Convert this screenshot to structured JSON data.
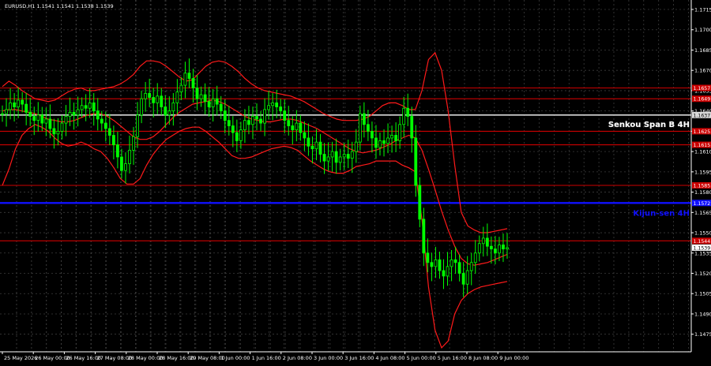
{
  "header": {
    "symbol_info": "EURUSD,H1  1.1541 1.1541 1.1538 1.1539"
  },
  "colors": {
    "background": "#000000",
    "grid": "#3c3c3c",
    "axis": "#ffffff",
    "candle": "#00ff00",
    "bollinger": "#ff1a1a",
    "levels": "#cc0000",
    "kijun": "#1010ff",
    "senkou": "#d9d9d9",
    "price_tag": "#cc0000"
  },
  "chart_data": {
    "type": "line",
    "title": "EURUSD,H1  1.1541 1.1541 1.1538 1.1539",
    "xlabel": "",
    "ylabel": "",
    "ylim": [
      1.1462,
      1.1722
    ],
    "price_ticks": [
      1.1475,
      1.149,
      1.1505,
      1.152,
      1.1535,
      1.155,
      1.1565,
      1.158,
      1.1595,
      1.161,
      1.1625,
      1.164,
      1.1655,
      1.167,
      1.1685,
      1.17,
      1.1715
    ],
    "time_labels": [
      "25 May 2026",
      "26 May 00:00",
      "26 May 16:00",
      "27 May 08:00",
      "28 May 00:00",
      "28 May 16:00",
      "29 May 08:00",
      "1 Jun 00:00",
      "1 Jun 16:00",
      "2 Jun 08:00",
      "3 Jun 00:00",
      "3 Jun 16:00",
      "4 Jun 08:00",
      "5 Jun 00:00",
      "5 Jun 16:00",
      "8 Jun 08:00",
      "9 Jun 00:00"
    ],
    "horizontal_levels": [
      {
        "value": 1.1657,
        "label": "1.1657",
        "kind": "support-resistance"
      },
      {
        "value": 1.1649,
        "label": "1.1649",
        "kind": "support-resistance"
      },
      {
        "value": 1.1637,
        "label": "1.1637",
        "kind": "senkou"
      },
      {
        "value": 1.1625,
        "label": "1.1625",
        "kind": "support-resistance"
      },
      {
        "value": 1.1615,
        "label": "1.1615",
        "kind": "support-resistance"
      },
      {
        "value": 1.1585,
        "label": "1.1585",
        "kind": "support-resistance"
      },
      {
        "value": 1.1572,
        "label": "1.1572",
        "kind": "kijun"
      },
      {
        "value": 1.1544,
        "label": "1.1544",
        "kind": "support-resistance"
      },
      {
        "value": 1.1539,
        "label": "1.1539",
        "kind": "current"
      }
    ],
    "annotations": [
      {
        "text": "Senkou Span B 4H",
        "anchor_value": 1.1637
      },
      {
        "text": "Kijun-sen 4H",
        "anchor_value": 1.1572
      }
    ],
    "series": [
      {
        "kind": "close",
        "values": [
          1.1638,
          1.1641,
          1.1646,
          1.1643,
          1.1648,
          1.1645,
          1.1639,
          1.1636,
          1.1633,
          1.1637,
          1.1631,
          1.1634,
          1.1627,
          1.1623,
          1.1625,
          1.1631,
          1.1636,
          1.1639,
          1.1637,
          1.1641,
          1.1644,
          1.1642,
          1.1646,
          1.164,
          1.1634,
          1.1631,
          1.1627,
          1.1622,
          1.1615,
          1.1606,
          1.1596,
          1.1601,
          1.1611,
          1.1621,
          1.1637,
          1.1649,
          1.1653,
          1.165,
          1.1646,
          1.1651,
          1.1643,
          1.1637,
          1.164,
          1.1646,
          1.1654,
          1.1659,
          1.1668,
          1.1664,
          1.1657,
          1.1649,
          1.1652,
          1.1647,
          1.1643,
          1.1649,
          1.1645,
          1.164,
          1.1633,
          1.1629,
          1.1624,
          1.1618,
          1.1626,
          1.1633,
          1.163,
          1.1636,
          1.1634,
          1.1631,
          1.1641,
          1.1644,
          1.1646,
          1.1643,
          1.164,
          1.1633,
          1.1629,
          1.1626,
          1.1631,
          1.1624,
          1.162,
          1.1614,
          1.1612,
          1.1617,
          1.1608,
          1.1603,
          1.1606,
          1.161,
          1.1602,
          1.1606,
          1.1608,
          1.1605,
          1.161,
          1.1617,
          1.1638,
          1.163,
          1.1625,
          1.162,
          1.1613,
          1.1618,
          1.1616,
          1.162,
          1.1622,
          1.1618,
          1.163,
          1.1642,
          1.1636,
          1.162,
          1.1585,
          1.156,
          1.1535,
          1.1528,
          1.1525,
          1.153,
          1.1522,
          1.1518,
          1.1525,
          1.153,
          1.1528,
          1.152,
          1.1512,
          1.1522,
          1.1528,
          1.1535,
          1.1542,
          1.1546,
          1.154,
          1.1538,
          1.1535,
          1.1541,
          1.1538,
          1.1539
        ]
      },
      {
        "kind": "bollinger-middle",
        "values": [
          1.164,
          1.1641,
          1.1641,
          1.164,
          1.1639,
          1.1638,
          1.1636,
          1.1634,
          1.1633,
          1.1632,
          1.1632,
          1.1633,
          1.1635,
          1.1637,
          1.1638,
          1.1638,
          1.1636,
          1.1633,
          1.1629,
          1.1625,
          1.1621,
          1.1619,
          1.1619,
          1.1621,
          1.1625,
          1.163,
          1.1635,
          1.1639,
          1.1642,
          1.1645,
          1.1646,
          1.1647,
          1.1648,
          1.1647,
          1.1645,
          1.1642,
          1.1639,
          1.1636,
          1.1634,
          1.1633,
          1.1632,
          1.1632,
          1.1633,
          1.1634,
          1.1634,
          1.1633,
          1.1631,
          1.1629,
          1.1627,
          1.1624,
          1.1621,
          1.1618,
          1.1615,
          1.1612,
          1.161,
          1.1609,
          1.161,
          1.1611,
          1.1613,
          1.1615,
          1.1618,
          1.162,
          1.1622,
          1.162,
          1.1611,
          1.1597,
          1.1582,
          1.1566,
          1.1552,
          1.154,
          1.1531,
          1.1527,
          1.1526,
          1.1527,
          1.1528,
          1.153,
          1.1532,
          1.1534
        ]
      },
      {
        "kind": "bollinger-upper",
        "values": [
          1.1658,
          1.1662,
          1.1659,
          1.1655,
          1.1652,
          1.1649,
          1.1648,
          1.1647,
          1.1648,
          1.1651,
          1.1654,
          1.1656,
          1.1657,
          1.1655,
          1.1655,
          1.1656,
          1.1657,
          1.1658,
          1.166,
          1.1663,
          1.1667,
          1.1673,
          1.1677,
          1.1677,
          1.1676,
          1.1673,
          1.1669,
          1.1665,
          1.1662,
          1.1663,
          1.1668,
          1.1673,
          1.1676,
          1.1677,
          1.1676,
          1.1673,
          1.1669,
          1.1664,
          1.166,
          1.1657,
          1.1655,
          1.1654,
          1.1653,
          1.1652,
          1.1651,
          1.1649,
          1.1647,
          1.1644,
          1.1641,
          1.1638,
          1.1636,
          1.1634,
          1.1633,
          1.1633,
          1.1633,
          1.1634,
          1.1636,
          1.164,
          1.1644,
          1.1646,
          1.1646,
          1.1644,
          1.1641,
          1.1641,
          1.1655,
          1.1678,
          1.1683,
          1.167,
          1.164,
          1.16,
          1.1565,
          1.1555,
          1.1552,
          1.155,
          1.155,
          1.1551,
          1.1552,
          1.1553
        ]
      },
      {
        "kind": "bollinger-lower",
        "values": [
          1.1585,
          1.1597,
          1.1612,
          1.1622,
          1.1627,
          1.163,
          1.1628,
          1.1625,
          1.162,
          1.1616,
          1.1614,
          1.1615,
          1.1617,
          1.1615,
          1.1612,
          1.161,
          1.1605,
          1.1598,
          1.159,
          1.1586,
          1.1586,
          1.159,
          1.16,
          1.1608,
          1.1614,
          1.1619,
          1.1622,
          1.1625,
          1.1627,
          1.1628,
          1.1628,
          1.1625,
          1.1621,
          1.1617,
          1.1612,
          1.1607,
          1.1605,
          1.1605,
          1.1606,
          1.1608,
          1.161,
          1.1612,
          1.1613,
          1.1614,
          1.1613,
          1.1611,
          1.1607,
          1.1603,
          1.16,
          1.1597,
          1.1595,
          1.1594,
          1.1594,
          1.1596,
          1.1599,
          1.16,
          1.1601,
          1.1603,
          1.1603,
          1.1603,
          1.1603,
          1.16,
          1.1598,
          1.1595,
          1.156,
          1.151,
          1.1478,
          1.1465,
          1.147,
          1.149,
          1.15,
          1.1505,
          1.1508,
          1.151,
          1.1511,
          1.1512,
          1.1513,
          1.1514
        ]
      }
    ]
  }
}
